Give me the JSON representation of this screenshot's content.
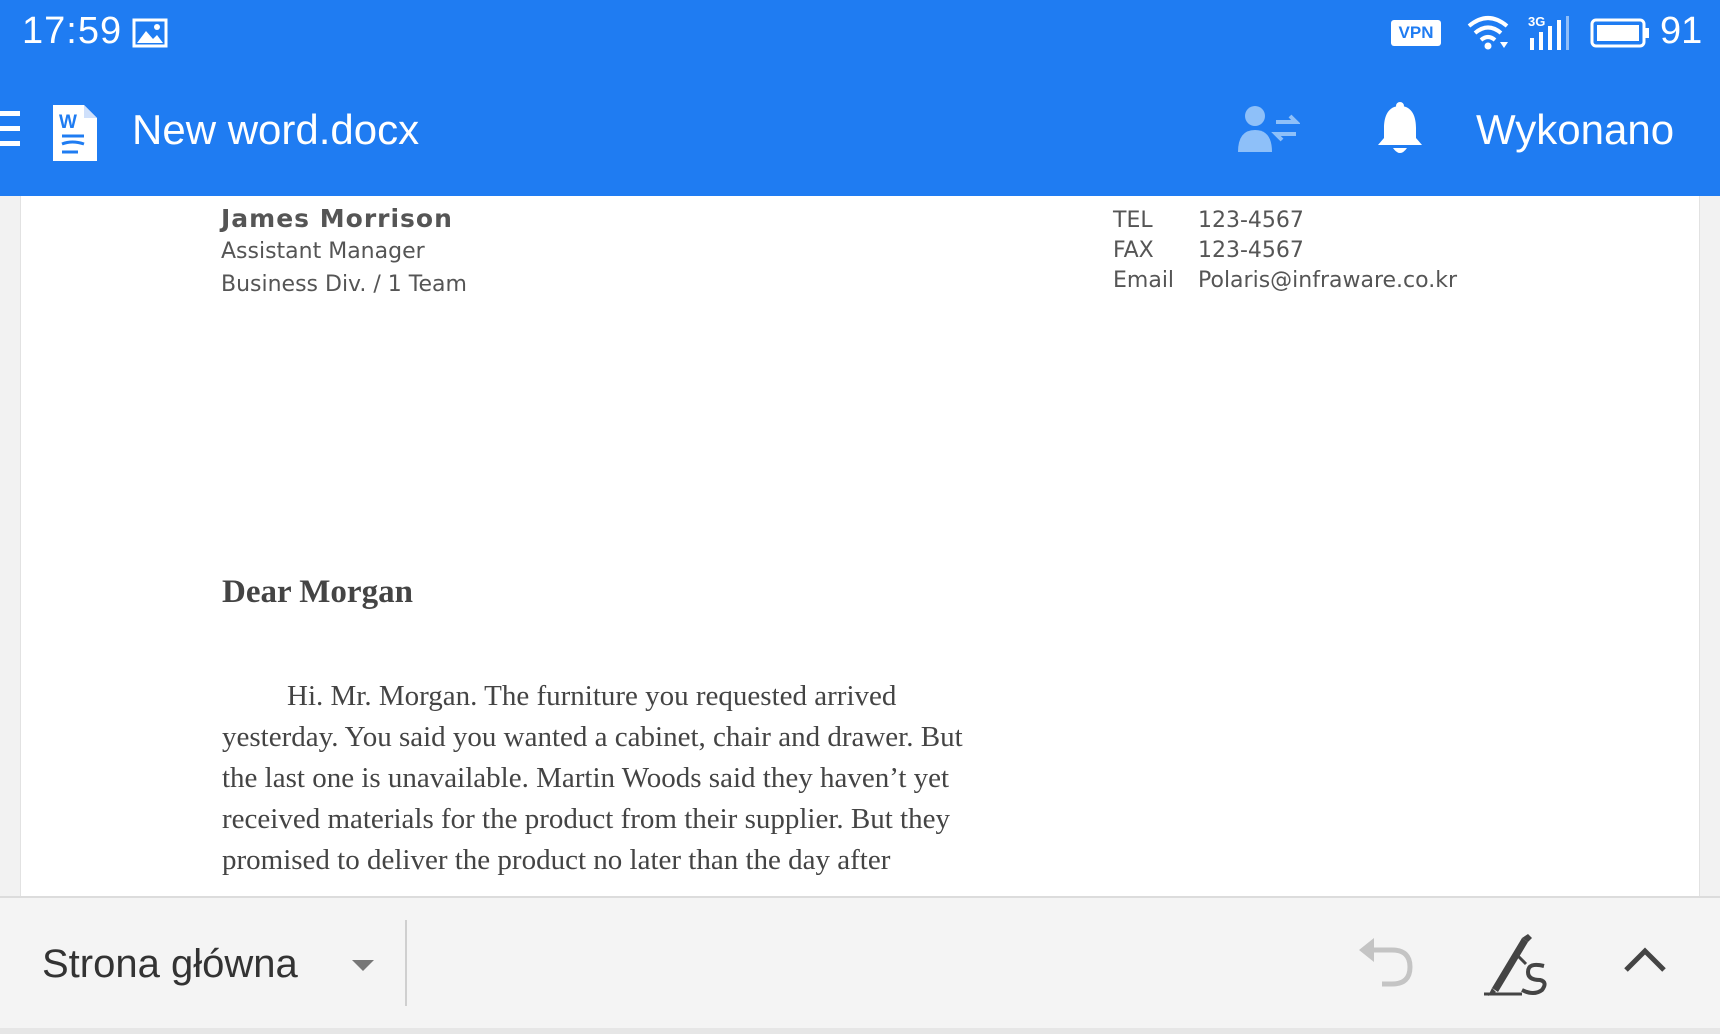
{
  "status_bar": {
    "time": "17:59",
    "vpn_label": "VPN",
    "network_label": "3G",
    "battery_level": "91",
    "icons": [
      "gallery-icon",
      "wifi-icon",
      "signal-icon",
      "battery-icon"
    ]
  },
  "app_bar": {
    "doc_title": "New word.docx",
    "done_label": "Wykonano",
    "icons": [
      "menu-icon",
      "word-document-icon",
      "share-user-icon",
      "bell-icon"
    ],
    "color": "#1f7cf2"
  },
  "document": {
    "sender": {
      "name": "James Morrison",
      "position": "Assistant Manager",
      "division": "Business Div. / 1 Team"
    },
    "contact": [
      {
        "label": "TEL",
        "value": "123-4567"
      },
      {
        "label": "FAX",
        "value": "123-4567"
      },
      {
        "label": "Email",
        "value": "Polaris@infraware.co.kr"
      }
    ],
    "greeting": "Dear Morgan",
    "body_lines": [
      "Hi. Mr. Morgan. The furniture you requested arrived",
      "yesterday. You said you wanted a cabinet, chair and drawer. But",
      "the last one is unavailable. Martin Woods said they haven’t yet",
      "received materials for the product from their supplier. But they",
      "promised to deliver the product no later than the day after"
    ]
  },
  "toolbar": {
    "tab_label": "Strona główna",
    "icons": [
      "dropdown-caret-icon",
      "undo-icon",
      "pen-icon",
      "collapse-icon"
    ]
  }
}
